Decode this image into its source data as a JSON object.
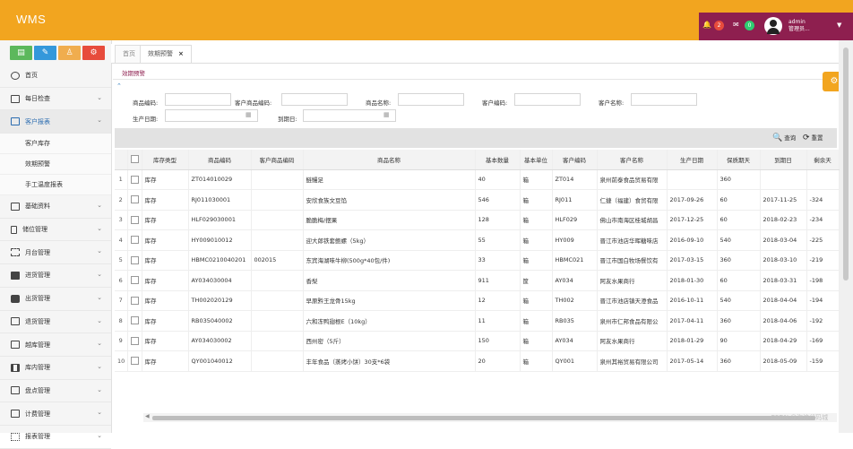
{
  "app": {
    "title": "WMS"
  },
  "header": {
    "notifications": {
      "icon": "bell-icon",
      "count": "2",
      "color": "#e74c3c"
    },
    "messages": {
      "icon": "envelope-icon",
      "count": "0",
      "color": "#2ecc71"
    },
    "user": {
      "name": "admin",
      "role": "管理员..."
    }
  },
  "sidebar": {
    "shortcut_buttons": [
      {
        "icon": "chart-icon",
        "color": "#5cb85c"
      },
      {
        "icon": "pencil-icon",
        "color": "#3498db"
      },
      {
        "icon": "users-icon",
        "color": "#f0ad4e"
      },
      {
        "icon": "cogs-icon",
        "color": "#e74c3c"
      }
    ],
    "items": [
      {
        "label": "首页",
        "icon": "dashboard-icon"
      },
      {
        "label": "每日检查",
        "icon": "table-icon"
      },
      {
        "label": "客户报表",
        "icon": "table-icon"
      },
      {
        "label": "基础资料",
        "icon": "file-icon"
      },
      {
        "label": "储位管理",
        "icon": "mobile-icon"
      },
      {
        "label": "月台管理",
        "icon": "list-icon"
      },
      {
        "label": "进货管理",
        "icon": "checkbox-icon"
      },
      {
        "label": "出货管理",
        "icon": "truck-icon"
      },
      {
        "label": "退货管理",
        "icon": "table-icon"
      },
      {
        "label": "越库管理",
        "icon": "table-icon"
      },
      {
        "label": "库内管理",
        "icon": "film-icon"
      },
      {
        "label": "盘点管理",
        "icon": "table-icon"
      },
      {
        "label": "计费管理",
        "icon": "table-icon"
      },
      {
        "label": "报表管理",
        "icon": "chart-icon"
      }
    ],
    "subitems": [
      "客户库存",
      "效期预警",
      "手工温度报表"
    ]
  },
  "tabs": [
    {
      "label": "首页"
    },
    {
      "label": "效期预警",
      "close": "×"
    }
  ],
  "page": {
    "title": "效期预警",
    "collapse_icon": "⌃"
  },
  "filters": {
    "goods_code": "商品编码:",
    "cust_goods_code": "客户商品编码:",
    "goods_name": "商品名称:",
    "cust_code": "客户编码:",
    "cust_name": "客户名称:",
    "prod_date": "生产日期:",
    "expire_date": "到期日:"
  },
  "toolbar": {
    "search": "查询",
    "reset": "重置"
  },
  "table": {
    "columns": [
      "",
      "",
      "库存类型",
      "商品编码",
      "客户商品编码",
      "商品名称",
      "基本数量",
      "基本单位",
      "客户编码",
      "客户名称",
      "生产日期",
      "保质期天",
      "到期日",
      "剩余天"
    ],
    "rows": [
      [
        "1",
        "库存",
        "ZT014010029",
        "",
        "鲢鳗足",
        "40",
        "箱",
        "ZT014",
        "泉州前泰食品贸易有限",
        "",
        "360",
        "",
        ""
      ],
      [
        "2",
        "库存",
        "RJ011030001",
        "",
        "安欣食族文豆馅",
        "546",
        "箱",
        "RJ011",
        "仁捷（福建）食贸有限",
        "2017-09-26",
        "60",
        "2017-11-25",
        "-324"
      ],
      [
        "3",
        "库存",
        "HLF029030001",
        "",
        "脆脆梅/摆果",
        "128",
        "箱",
        "HLF029",
        "佛山市南海区桂城胡昌",
        "2017-12-25",
        "60",
        "2018-02-23",
        "-234"
      ],
      [
        "4",
        "库存",
        "HY009010012",
        "",
        "迎大郎铁套鲍螺（5kg）",
        "55",
        "箱",
        "HY009",
        "晋江市池店华晖糖味店",
        "2016-09-10",
        "540",
        "2018-03-04",
        "-225"
      ],
      [
        "5",
        "库存",
        "HBMC0210040201",
        "002015",
        "东宾海湖味牛柳(500g*40包/件)",
        "33",
        "箱",
        "HBMC021",
        "晋江市国白牧场餐饮有",
        "2017-03-15",
        "360",
        "2018-03-10",
        "-219"
      ],
      [
        "6",
        "库存",
        "AY034030004",
        "",
        "香梨",
        "911",
        "筐",
        "AY034",
        "阿友水果商行",
        "2018-01-30",
        "60",
        "2018-03-31",
        "-198"
      ],
      [
        "7",
        "库存",
        "TH002020129",
        "",
        "早原黔王龙骨15kg",
        "12",
        "箱",
        "TH002",
        "晋江市池店镇天澄食品",
        "2016-10-11",
        "540",
        "2018-04-04",
        "-194"
      ],
      [
        "8",
        "库存",
        "RB035040002",
        "",
        "六和冻鸭翅根E（10kg）",
        "11",
        "箱",
        "RB035",
        "泉州市仁邦食品有限公",
        "2017-04-11",
        "360",
        "2018-04-06",
        "-192"
      ],
      [
        "9",
        "库存",
        "AY034030002",
        "",
        "西州密（5斤）",
        "150",
        "箱",
        "AY034",
        "阿友水果商行",
        "2018-01-29",
        "90",
        "2018-04-29",
        "-169"
      ],
      [
        "10",
        "库存",
        "QY001040012",
        "",
        "丰年食品（蒸烤小饼）30支*6袋",
        "20",
        "箱",
        "QY001",
        "泉州其裕贸易有限公司",
        "2017-05-14",
        "360",
        "2018-05-09",
        "-159"
      ]
    ]
  },
  "watermark": "CSDN @海浪代码城"
}
